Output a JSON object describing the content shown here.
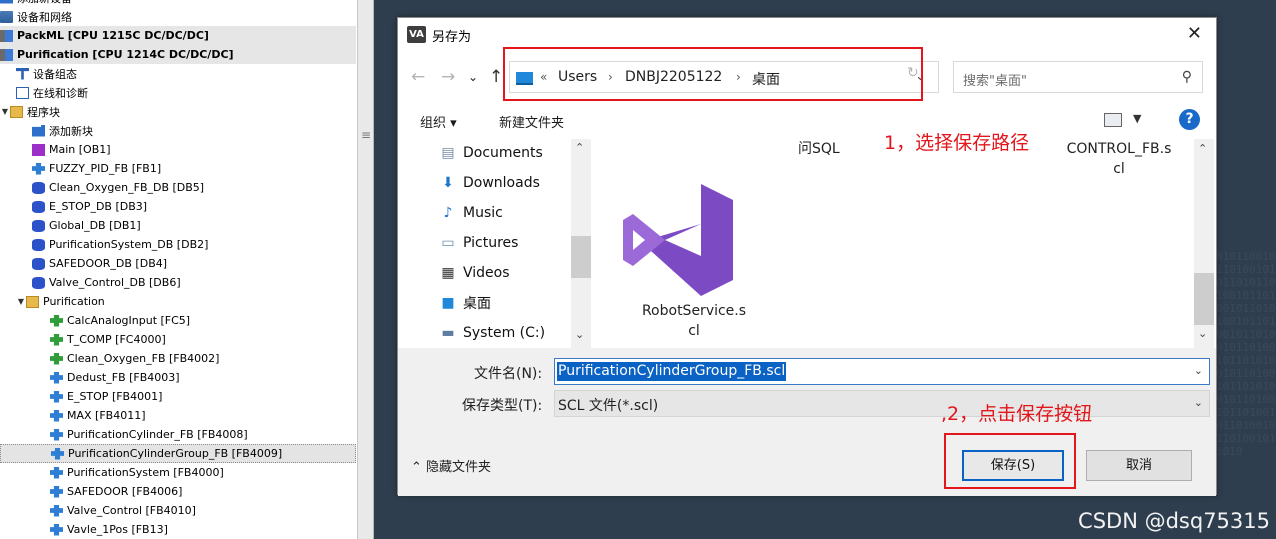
{
  "tree": {
    "items": [
      {
        "label": "添加新设备",
        "icon": "add-device-icon",
        "indent": 0
      },
      {
        "label": "设备和网络",
        "icon": "network-icon",
        "indent": 0
      },
      {
        "label": "PackML [CPU 1215C DC/DC/DC]",
        "icon": "cpu-icon",
        "indent": 0,
        "bold": true
      },
      {
        "label": "Purification [CPU 1214C DC/DC/DC]",
        "icon": "cpu-icon",
        "indent": 0,
        "bold": true
      },
      {
        "label": "设备组态",
        "icon": "device-config-icon",
        "indent": 1
      },
      {
        "label": "在线和诊断",
        "icon": "diagnostics-icon",
        "indent": 1
      },
      {
        "label": "程序块",
        "icon": "folder-icon",
        "indent": 0,
        "expanded": true
      },
      {
        "label": "添加新块",
        "icon": "add-block-icon",
        "indent": 2
      },
      {
        "label": "Main [OB1]",
        "icon": "ob-icon",
        "indent": 2
      },
      {
        "label": "FUZZY_PID_FB [FB1]",
        "icon": "fb-icon",
        "indent": 2
      },
      {
        "label": "Clean_Oxygen_FB_DB [DB5]",
        "icon": "db-icon",
        "indent": 2
      },
      {
        "label": "E_STOP_DB [DB3]",
        "icon": "db-icon",
        "indent": 2
      },
      {
        "label": "Global_DB [DB1]",
        "icon": "db-icon",
        "indent": 2
      },
      {
        "label": "PurificationSystem_DB [DB2]",
        "icon": "db-icon",
        "indent": 2
      },
      {
        "label": "SAFEDOOR_DB [DB4]",
        "icon": "db-icon",
        "indent": 2
      },
      {
        "label": "Valve_Control_DB [DB6]",
        "icon": "db-icon",
        "indent": 2
      },
      {
        "label": "Purification",
        "icon": "folder-icon",
        "indent": 1,
        "expanded": true
      },
      {
        "label": "CalcAnalogInput [FC5]",
        "icon": "fc-icon",
        "indent": 3
      },
      {
        "label": "T_COMP [FC4000]",
        "icon": "fc-icon",
        "indent": 3
      },
      {
        "label": "Clean_Oxygen_FB [FB4002]",
        "icon": "fc-icon",
        "indent": 3
      },
      {
        "label": "Dedust_FB [FB4003]",
        "icon": "fb-icon",
        "indent": 3
      },
      {
        "label": "E_STOP [FB4001]",
        "icon": "fb-icon",
        "indent": 3
      },
      {
        "label": "MAX [FB4011]",
        "icon": "fb-icon",
        "indent": 3
      },
      {
        "label": "PurificationCylinder_FB [FB4008]",
        "icon": "fb-icon",
        "indent": 3
      },
      {
        "label": "PurificationCylinderGroup_FB [FB4009]",
        "icon": "fb-icon",
        "indent": 3,
        "selected": true
      },
      {
        "label": "PurificationSystem [FB4000]",
        "icon": "fb-icon",
        "indent": 3
      },
      {
        "label": "SAFEDOOR [FB4006]",
        "icon": "fb-icon",
        "indent": 3
      },
      {
        "label": "Valve_Control [FB4010]",
        "icon": "fb-icon",
        "indent": 3
      },
      {
        "label": "Vavle_1Pos [FB13]",
        "icon": "fb-icon",
        "indent": 3
      }
    ]
  },
  "dialog": {
    "title": "另存为",
    "title_icon": "VA",
    "close": "✕",
    "address": {
      "prefix": "«",
      "crumbs": [
        "Users",
        "DNBJ2205122",
        "桌面"
      ]
    },
    "search_placeholder": "搜索\"桌面\"",
    "organize": "组织 ▾",
    "new_folder": "新建文件夹",
    "help": "?",
    "nav_items": [
      {
        "label": "Documents",
        "icon": "documents-icon"
      },
      {
        "label": "Downloads",
        "icon": "downloads-icon"
      },
      {
        "label": "Music",
        "icon": "music-icon"
      },
      {
        "label": "Pictures",
        "icon": "pictures-icon"
      },
      {
        "label": "Videos",
        "icon": "videos-icon"
      },
      {
        "label": "桌面",
        "icon": "desktop-icon"
      },
      {
        "label": "System (C:)",
        "icon": "drive-icon"
      }
    ],
    "files": {
      "partial_left": "问SQL",
      "robot_line1": "RobotService.s",
      "robot_line2": "cl",
      "control_line1": "CONTROL_FB.s",
      "control_line2": "cl"
    },
    "filename_label": "文件名(N):",
    "filename_value": "PurificationCylinderGroup_FB.scl",
    "filetype_label": "保存类型(T):",
    "filetype_value": "SCL 文件(*.scl)",
    "hide_folders": "隐藏文件夹",
    "save": "保存(S)",
    "cancel": "取消"
  },
  "annotations": {
    "note1": "1，选择保存路径",
    "note2": ",2，点击保存按钮",
    "color": "#e2161b"
  },
  "watermark": "CSDN @dsq75315"
}
